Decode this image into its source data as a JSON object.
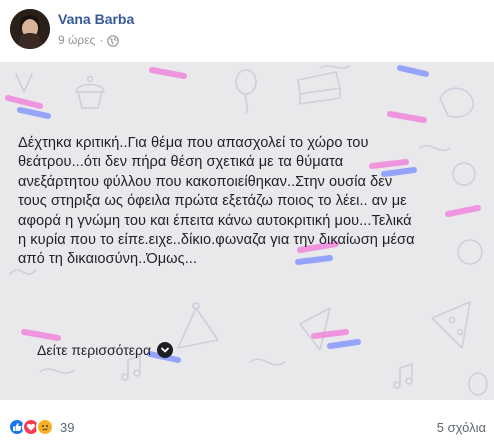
{
  "post": {
    "author_name": "Vana Barba",
    "timestamp": "9 ώρες",
    "separator": "·",
    "privacy_icon": "globe-icon",
    "text_lines": [
      "Δέχτηκα κριτική..Για θέμα που απασχολεί το χώρο του",
      "θεάτρου...ότι δεν πήρα θέση σχετικά με τα θύματα",
      "ανεξάρτητου φύλλου που κακοποιείθηκαν..Στην ουσία δεν",
      "τους στηριξα ως όφειλα πρώτα εξετάζω ποιος το λέει.. αν με",
      "αφορά η γνώμη του και έπειτα κάνω αυτοκριτική μου...Τελικά",
      "η κυρία που το είπε.ειχε..δίκιο.φωναζα για την δικαίωση μέσα",
      "από τη δικαιοσύνη..Όμως..."
    ],
    "see_more_label": "Δείτε περισσότερα",
    "background_color": "#e9e9ec"
  },
  "footer": {
    "reactions": [
      "like-icon",
      "love-icon",
      "sad-icon"
    ],
    "reaction_count": "39",
    "comments_label": "5 σχόλια"
  },
  "colors": {
    "author": "#385898",
    "like": "#1877f2",
    "love": "#f33e58",
    "sad": "#f7b125",
    "pattern_pink": "#f07ad8",
    "pattern_blue": "#7a8cff"
  }
}
